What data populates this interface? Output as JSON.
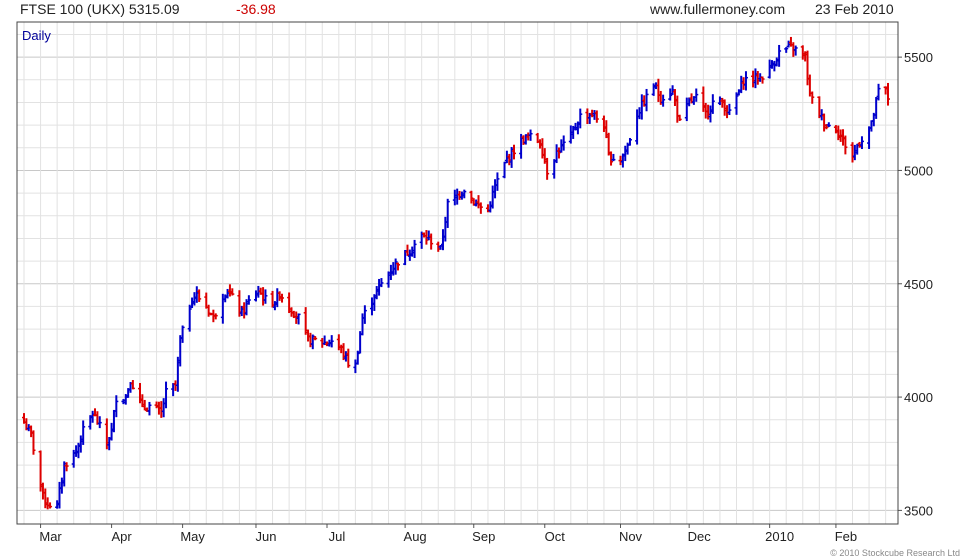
{
  "header": {
    "symbol": "FTSE 100 (UKX) 5315.09",
    "change": "-36.98",
    "site": "www.fullermoney.com",
    "date": "23 Feb 2010"
  },
  "footer": {
    "copyright": "© 2010 Stockcube Research Ltd"
  },
  "colors": {
    "up": "#0000cc",
    "down": "#dd0000",
    "grid": "#e2e2e2",
    "major_grid": "#c8c8c8"
  },
  "chart_data": {
    "type": "ohlc",
    "label": "Daily",
    "ylim": [
      3440,
      5655
    ],
    "yticks": [
      3500,
      4000,
      4500,
      5000,
      5500
    ],
    "x_tick_labels": [
      "Mar",
      "Apr",
      "May",
      "Jun",
      "Jul",
      "Aug",
      "Sep",
      "Oct",
      "Nov",
      "Dec",
      "2010",
      "Feb"
    ],
    "x_tick_dates": [
      "2009-03-02",
      "2009-04-01",
      "2009-05-01",
      "2009-06-01",
      "2009-07-01",
      "2009-08-03",
      "2009-09-01",
      "2009-10-01",
      "2009-11-02",
      "2009-12-01",
      "2010-01-04",
      "2010-02-01"
    ],
    "x_range": [
      "2009-02-23",
      "2010-02-23"
    ],
    "close_path": [
      [
        "2009-02-23",
        3890
      ],
      [
        "2009-02-26",
        3830
      ],
      [
        "2009-03-03",
        3560
      ],
      [
        "2009-03-05",
        3530
      ],
      [
        "2009-03-09",
        3520
      ],
      [
        "2009-03-12",
        3700
      ],
      [
        "2009-03-17",
        3760
      ],
      [
        "2009-03-20",
        3850
      ],
      [
        "2009-03-24",
        3930
      ],
      [
        "2009-03-26",
        3890
      ],
      [
        "2009-03-30",
        3800
      ],
      [
        "2009-04-01",
        3850
      ],
      [
        "2009-04-03",
        4000
      ],
      [
        "2009-04-07",
        4000
      ],
      [
        "2009-04-09",
        4080
      ],
      [
        "2009-04-14",
        3950
      ],
      [
        "2009-04-17",
        3960
      ],
      [
        "2009-04-22",
        3930
      ],
      [
        "2009-04-24",
        4020
      ],
      [
        "2009-04-28",
        4050
      ],
      [
        "2009-04-30",
        4250
      ],
      [
        "2009-05-05",
        4440
      ],
      [
        "2009-05-07",
        4450
      ],
      [
        "2009-05-11",
        4400
      ],
      [
        "2009-05-14",
        4350
      ],
      [
        "2009-05-18",
        4450
      ],
      [
        "2009-05-20",
        4470
      ],
      [
        "2009-05-26",
        4370
      ],
      [
        "2009-05-29",
        4420
      ],
      [
        "2009-06-02",
        4470
      ],
      [
        "2009-06-05",
        4430
      ],
      [
        "2009-06-09",
        4420
      ],
      [
        "2009-06-11",
        4460
      ],
      [
        "2009-06-15",
        4400
      ],
      [
        "2009-06-19",
        4350
      ],
      [
        "2009-06-23",
        4250
      ],
      [
        "2009-06-26",
        4250
      ],
      [
        "2009-06-30",
        4240
      ],
      [
        "2009-07-03",
        4250
      ],
      [
        "2009-07-07",
        4210
      ],
      [
        "2009-07-10",
        4150
      ],
      [
        "2009-07-13",
        4140
      ],
      [
        "2009-07-16",
        4350
      ],
      [
        "2009-07-21",
        4450
      ],
      [
        "2009-07-27",
        4550
      ],
      [
        "2009-07-31",
        4600
      ],
      [
        "2009-08-05",
        4650
      ],
      [
        "2009-08-10",
        4710
      ],
      [
        "2009-08-14",
        4690
      ],
      [
        "2009-08-18",
        4650
      ],
      [
        "2009-08-21",
        4850
      ],
      [
        "2009-08-26",
        4900
      ],
      [
        "2009-08-28",
        4920
      ],
      [
        "2009-09-02",
        4850
      ],
      [
        "2009-09-07",
        4820
      ],
      [
        "2009-09-10",
        4930
      ],
      [
        "2009-09-15",
        5050
      ],
      [
        "2009-09-21",
        5130
      ],
      [
        "2009-09-24",
        5150
      ],
      [
        "2009-09-29",
        5130
      ],
      [
        "2009-10-02",
        5000
      ],
      [
        "2009-10-06",
        5080
      ],
      [
        "2009-10-12",
        5150
      ],
      [
        "2009-10-16",
        5240
      ],
      [
        "2009-10-21",
        5250
      ],
      [
        "2009-10-26",
        5200
      ],
      [
        "2009-10-28",
        5060
      ],
      [
        "2009-11-02",
        5050
      ],
      [
        "2009-11-05",
        5110
      ],
      [
        "2009-11-09",
        5250
      ],
      [
        "2009-11-13",
        5320
      ],
      [
        "2009-11-16",
        5380
      ],
      [
        "2009-11-19",
        5320
      ],
      [
        "2009-11-24",
        5350
      ],
      [
        "2009-11-27",
        5210
      ],
      [
        "2009-12-01",
        5300
      ],
      [
        "2009-12-04",
        5320
      ],
      [
        "2009-12-08",
        5250
      ],
      [
        "2009-12-11",
        5300
      ],
      [
        "2009-12-15",
        5300
      ],
      [
        "2009-12-18",
        5250
      ],
      [
        "2009-12-22",
        5350
      ],
      [
        "2009-12-24",
        5400
      ],
      [
        "2009-12-31",
        5410
      ],
      [
        "2010-01-04",
        5450
      ],
      [
        "2010-01-08",
        5520
      ],
      [
        "2010-01-12",
        5540
      ],
      [
        "2010-01-14",
        5540
      ],
      [
        "2010-01-19",
        5500
      ],
      [
        "2010-01-21",
        5330
      ],
      [
        "2010-01-25",
        5250
      ],
      [
        "2010-01-28",
        5200
      ],
      [
        "2010-02-01",
        5190
      ],
      [
        "2010-02-04",
        5130
      ],
      [
        "2010-02-08",
        5060
      ],
      [
        "2010-02-10",
        5110
      ],
      [
        "2010-02-12",
        5140
      ],
      [
        "2010-02-16",
        5200
      ],
      [
        "2010-02-19",
        5350
      ],
      [
        "2010-02-22",
        5352
      ],
      [
        "2010-02-23",
        5315
      ]
    ],
    "grid": true,
    "axis_position": "right"
  }
}
